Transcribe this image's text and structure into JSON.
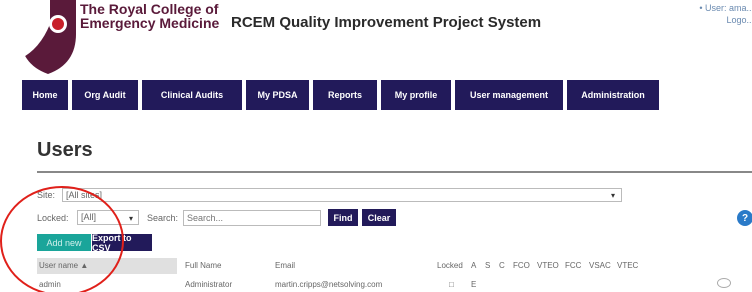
{
  "header": {
    "college_line1": "The Royal College of",
    "college_line2": "Emergency Medicine",
    "system_title": "RCEM Quality Improvement Project System",
    "user_line1": "• User: ama...",
    "user_line2": "Logo..."
  },
  "nav": [
    {
      "label": "Home"
    },
    {
      "label": "Org Audit"
    },
    {
      "label": "Clinical Audits"
    },
    {
      "label": "My PDSA"
    },
    {
      "label": "Reports"
    },
    {
      "label": "My profile"
    },
    {
      "label": "User management"
    },
    {
      "label": "Administration"
    }
  ],
  "page": {
    "title": "Users"
  },
  "filters": {
    "site_label": "Site:",
    "site_value": "[All sites]",
    "locked_label": "Locked:",
    "locked_value": "[All]",
    "search_label": "Search:",
    "search_placeholder": "Search...",
    "find_label": "Find",
    "clear_label": "Clear",
    "help_label": "?"
  },
  "actions": {
    "add_new_label": "Add new",
    "export_label": "Export to CSV"
  },
  "table": {
    "columns": [
      "User name ▲",
      "Full Name",
      "Email",
      "Locked",
      "A",
      "S",
      "C",
      "FCO",
      "VTEO",
      "FCC",
      "VSAC",
      "VTEC"
    ],
    "rows": [
      {
        "username": "admin",
        "full_name": "Administrator",
        "email": "martin.cripps@netsolving.com",
        "locked": "□",
        "a": "E"
      }
    ]
  },
  "colors": {
    "nav_bg": "#221a5a",
    "accent_teal": "#1aa59a",
    "annotation_red": "#e0201a",
    "brand_maroon": "#5a1a3a"
  }
}
